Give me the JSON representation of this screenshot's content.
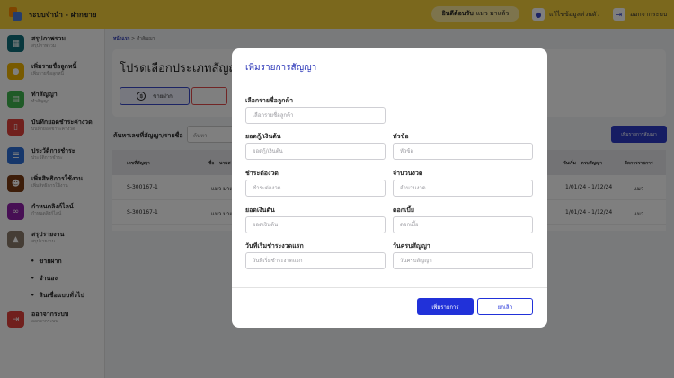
{
  "app": {
    "title": "ระบบจำนำ - ฝากขาย"
  },
  "topbar": {
    "welcome_prefix": "ยินดีต้อนรับ",
    "welcome_user": "แมว มาแล้ว",
    "edit_profile": "แก้ไขข้อมูลส่วนตัว",
    "logout": "ออกจากระบบ"
  },
  "sidebar": {
    "items": [
      {
        "label": "สรุปภาพรวม",
        "sub": "สรุปภาพรวม",
        "icon": "dashboard-icon",
        "color": "#0f6e7a"
      },
      {
        "label": "เพิ่มรายชื่อลูกหนี้",
        "sub": "เพิ่มรายชื่อลูกหนี้",
        "icon": "add-debtor-icon",
        "color": "#f0b400"
      },
      {
        "label": "ทำสัญญา",
        "sub": "ทำสัญญา",
        "icon": "document-icon",
        "color": "#3fb54f"
      },
      {
        "label": "บันทึกยอดชำระค่างวด",
        "sub": "บันทึกยอดชำระค่างวด",
        "icon": "payment-icon",
        "color": "#e0413b"
      },
      {
        "label": "ประวัติการชำระ",
        "sub": "ประวัติการชำระ",
        "icon": "history-icon",
        "color": "#2d6fd6"
      },
      {
        "label": "เพิ่มสิทธิการใช้งาน",
        "sub": "เพิ่มสิทธิการใช้งาน",
        "icon": "users-icon",
        "color": "#7a3b12"
      },
      {
        "label": "กำหนดลิงก์ไลน์",
        "sub": "กำหนดลิงก์ไลน์",
        "icon": "link-icon",
        "color": "#8e1fa8"
      },
      {
        "label": "สรุปรายงาน",
        "sub": "สรุปรายงาน",
        "icon": "report-icon",
        "color": "#8a7a6a"
      }
    ],
    "subnav": [
      "ขายฝาก",
      "จำนอง",
      "สินเชื่อแบบทั่วไป"
    ],
    "logout": {
      "label": "ออกจากระบบ",
      "sub": "ออกจากระบบ",
      "icon": "logout-icon",
      "color": "#e0413b"
    }
  },
  "main": {
    "breadcrumb_home": "หน้าแรก",
    "breadcrumb_current": "ทำสัญญา",
    "panel_title": "โปรดเลือกประเภทสัญญา",
    "type_card_label": "ขายฝาก",
    "search_label": "ค้นหาเลขที่สัญญา/รายชื่อ",
    "search_placeholder": "ค้นหา",
    "add_contract": "เพิ่มรายการสัญญา",
    "table": {
      "headers": [
        "เลขที่สัญญา",
        "ชื่อ - นามส",
        "วันเริ่ม - ครบสัญญา",
        "จัดการรายการ"
      ],
      "rows": [
        {
          "id": "S-300167-1",
          "name": "แมว มาแล",
          "dates": "1/01/24 - 1/12/24",
          "action": "แมว"
        },
        {
          "id": "S-300167-1",
          "name": "แมว มาแล",
          "dates": "1/01/24 - 1/12/24",
          "action": "แมว"
        }
      ]
    }
  },
  "modal": {
    "title": "เพิ่มรายการสัญญา",
    "fields": {
      "customer": {
        "label": "เลือกรายชื่อลูกค้า",
        "placeholder": "เลือกรายชื่อลูกค้า",
        "value": ""
      },
      "principal": {
        "label": "ยอดกู้/เงินต้น",
        "placeholder": "ยอดกู้/เงินต้น",
        "value": ""
      },
      "topic": {
        "label": "หัวข้อ",
        "placeholder": "หัวข้อ",
        "value": ""
      },
      "installment_payment": {
        "label": "ชำระต่องวด",
        "placeholder": "ชำระต่องวด",
        "value": ""
      },
      "installment_count": {
        "label": "จำนวนงวด",
        "placeholder": "จำนวนงวด",
        "value": ""
      },
      "balance": {
        "label": "ยอดเงินต้น",
        "placeholder": "ยอดเงินต้น",
        "value": ""
      },
      "interest": {
        "label": "ดอกเบี้ย",
        "placeholder": "ดอกเบี้ย",
        "value": ""
      },
      "first_payment_date": {
        "label": "วันที่เริ่มชำระงวดแรก",
        "placeholder": "วันที่เริ่มชำระงวดแรก",
        "value": ""
      },
      "due_date": {
        "label": "วันครบสัญญา",
        "placeholder": "วันครบสัญญา",
        "value": ""
      }
    },
    "submit": "เพิ่มรายการ",
    "cancel": "ยกเลิก"
  },
  "colors": {
    "topbar": "#f7d13a",
    "primary": "#2131d9",
    "modal_title": "#2a35b8"
  }
}
